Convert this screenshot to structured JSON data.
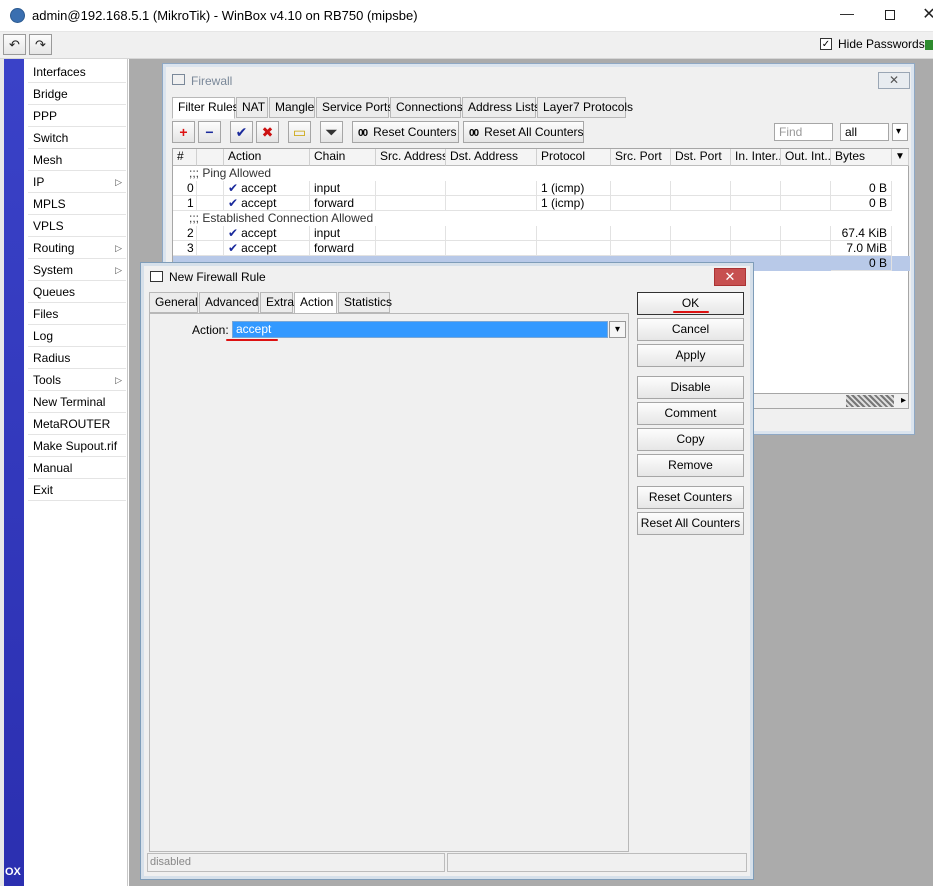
{
  "window": {
    "title": "admin@192.168.5.1 (MikroTik) - WinBox v4.10 on RB750 (mipsbe)",
    "min_glyph": "—",
    "close_glyph": "✕"
  },
  "toolbar": {
    "undo_glyph": "↶",
    "redo_glyph": "↷",
    "hide_passwords_label": "Hide Passwords",
    "hide_passwords_check": "✓"
  },
  "vertical_bar_text": "OX",
  "sidebar": {
    "items": [
      {
        "label": "Interfaces",
        "arrow": ""
      },
      {
        "label": "Bridge",
        "arrow": ""
      },
      {
        "label": "PPP",
        "arrow": ""
      },
      {
        "label": "Switch",
        "arrow": ""
      },
      {
        "label": "Mesh",
        "arrow": ""
      },
      {
        "label": "IP",
        "arrow": "▷"
      },
      {
        "label": "MPLS",
        "arrow": ""
      },
      {
        "label": "VPLS",
        "arrow": ""
      },
      {
        "label": "Routing",
        "arrow": "▷"
      },
      {
        "label": "System",
        "arrow": "▷"
      },
      {
        "label": "Queues",
        "arrow": ""
      },
      {
        "label": "Files",
        "arrow": ""
      },
      {
        "label": "Log",
        "arrow": ""
      },
      {
        "label": "Radius",
        "arrow": ""
      },
      {
        "label": "Tools",
        "arrow": "▷"
      },
      {
        "label": "New Terminal",
        "arrow": ""
      },
      {
        "label": "MetaROUTER",
        "arrow": ""
      },
      {
        "label": "Make Supout.rif",
        "arrow": ""
      },
      {
        "label": "Manual",
        "arrow": ""
      },
      {
        "label": "Exit",
        "arrow": ""
      }
    ]
  },
  "firewall": {
    "title": "Firewall",
    "close_glyph": "✕",
    "tabs": [
      "Filter Rules",
      "NAT",
      "Mangle",
      "Service Ports",
      "Connections",
      "Address Lists",
      "Layer7 Protocols"
    ],
    "buttons": {
      "add_glyph": "+",
      "remove_glyph": "−",
      "enable_glyph": "✔",
      "disable_glyph": "✖",
      "comment_glyph": "▭",
      "filter_glyph": "⏷",
      "reset_counters_icon": "00",
      "reset_counters": "Reset Counters",
      "reset_all_counters_icon": "00",
      "reset_all_counters": "Reset All Counters"
    },
    "find_placeholder": "Find",
    "filter_value": "all",
    "filter_dd_glyph": "▾",
    "columns": [
      "#",
      "",
      "Action",
      "Chain",
      "Src. Address",
      "Dst. Address",
      "Protocol",
      "Src. Port",
      "Dst. Port",
      "In. Inter...",
      "Out. Int...",
      "Bytes"
    ],
    "col_menu_glyph": "▼",
    "check_glyph": "✔",
    "rows": [
      {
        "comment": ";;; Ping Allowed"
      },
      {
        "num": "0",
        "action": "accept",
        "chain": "input",
        "protocol": "1 (icmp)",
        "bytes": "0 B"
      },
      {
        "num": "1",
        "action": "accept",
        "chain": "forward",
        "protocol": "1 (icmp)",
        "bytes": "0 B"
      },
      {
        "comment": ";;; Established Connection Allowed"
      },
      {
        "num": "2",
        "action": "accept",
        "chain": "input",
        "protocol": "",
        "bytes": "67.4 KiB"
      },
      {
        "num": "3",
        "action": "accept",
        "chain": "forward",
        "protocol": "",
        "bytes": "7.0 MiB"
      },
      {
        "num": "",
        "action": "",
        "chain": "",
        "protocol": "",
        "bytes": "0 B",
        "selected": true
      }
    ],
    "scroll_arrow": "▸"
  },
  "dialog": {
    "title": "New Firewall Rule",
    "close_glyph": "✕",
    "tabs": [
      "General",
      "Advanced",
      "Extra",
      "Action",
      "Statistics"
    ],
    "action_label": "Action:",
    "action_value": "accept",
    "action_dd_glyph": "▾",
    "buttons": [
      "OK",
      "Cancel",
      "Apply",
      "Disable",
      "Comment",
      "Copy",
      "Remove",
      "Reset Counters",
      "Reset All Counters"
    ],
    "status": "disabled",
    "annotation_color": "#dd1111"
  }
}
